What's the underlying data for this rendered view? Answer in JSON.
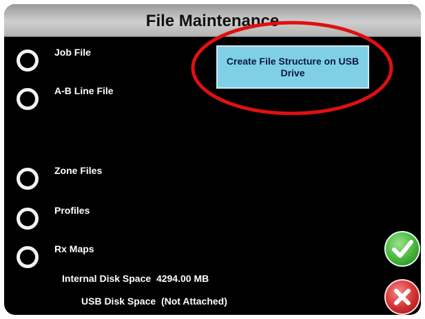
{
  "window": {
    "title": "File Maintenance"
  },
  "options": [
    {
      "label": "Job File",
      "icon": "radio-unselected-icon"
    },
    {
      "label": "A-B Line File",
      "icon": "radio-unselected-icon"
    },
    {
      "label": "Zone Files",
      "icon": "radio-unselected-icon"
    },
    {
      "label": "Profiles",
      "icon": "radio-unselected-icon"
    },
    {
      "label": "Rx Maps",
      "icon": "radio-unselected-icon"
    }
  ],
  "create_button": {
    "label": "Create File Structure on USB Drive"
  },
  "disk": {
    "internal_label": "Internal Disk Space",
    "internal_value": "4294.00 MB",
    "usb_label": "USB Disk Space",
    "usb_value": "(Not Attached)"
  },
  "actions": {
    "ok_icon": "checkmark-icon",
    "cancel_icon": "x-icon"
  },
  "colors": {
    "background": "#000000",
    "create_button": "#7fd0e6",
    "highlight_ring": "#e01010",
    "ok": "#47b33a",
    "cancel": "#d3302f"
  }
}
